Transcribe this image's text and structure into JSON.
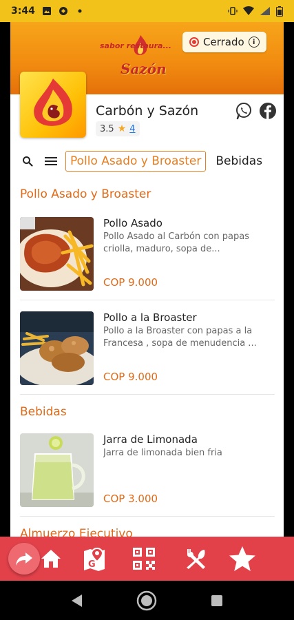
{
  "status_bar": {
    "time": "3:44"
  },
  "banner": {
    "slogan": "sabor restaura...",
    "brand": "Sazón",
    "status_label": "Cerrado",
    "info_glyph": "i",
    "brand_color": "#f18a10"
  },
  "restaurant": {
    "name": "Carbón y Sazón",
    "rating": "3.5",
    "review_count": "4",
    "star_glyph": "★"
  },
  "nav": {
    "tabs": [
      "Pollo Asado y Broaster",
      "Bebidas"
    ],
    "active_tab": 0
  },
  "sections": [
    {
      "title": "Pollo Asado y Broaster",
      "items": [
        {
          "name": "Pollo Asado",
          "description": "Pollo Asado al Carbón con papas criolla, maduro, sopa de...",
          "price": "COP 9.000"
        },
        {
          "name": "Pollo a la Broaster",
          "description": "Pollo a la Broaster con papas a la Francesa , sopa de menudencia ...",
          "price": "COP 9.000"
        }
      ]
    },
    {
      "title": "Bebidas",
      "items": [
        {
          "name": "Jarra de Limonada",
          "description": "Jarra de limonada bien fria",
          "price": "COP 3.000"
        }
      ]
    },
    {
      "title": "Almuerzo Ejecutivo",
      "items": []
    }
  ],
  "bottom_bar": {
    "icons": [
      "share-icon",
      "home-icon",
      "map-icon",
      "qr-code-icon",
      "menu-utensils-icon",
      "favorite-star-icon"
    ],
    "accent": "#e2414a"
  },
  "colors": {
    "accent": "#e06a18",
    "status_bar": "#f2c21b"
  }
}
